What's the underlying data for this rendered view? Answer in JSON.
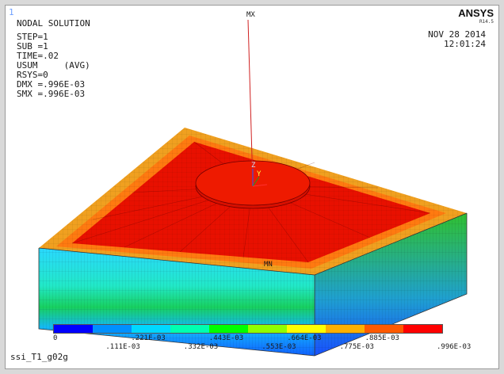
{
  "window": {
    "number": "1",
    "brand": "ANSYS",
    "brand_version": "R14.5",
    "date": "NOV 28 2014",
    "time": "12:01:24",
    "jobname": "ssi_T1_g02g"
  },
  "solution_info": {
    "title": "NODAL SOLUTION",
    "step": "STEP=1",
    "sub": "SUB =1",
    "time": "TIME=.02",
    "usum": "USUM     (AVG)",
    "rsys": "RSYS=0",
    "dmx": "DMX =.996E-03",
    "smx": "SMX =.996E-03"
  },
  "markers": {
    "max": "MX",
    "min": "MN",
    "axis_z": "Z",
    "axis_y": "Y"
  },
  "legend": {
    "colors": [
      "#0000ff",
      "#0090ff",
      "#00d8ff",
      "#00ffb0",
      "#00ff00",
      "#90ff00",
      "#ffff00",
      "#ffb000",
      "#ff5a00",
      "#ff0000"
    ],
    "top_labels": [
      "0",
      ".221E-03",
      ".443E-03",
      ".664E-03",
      ".885E-03"
    ],
    "bottom_labels": [
      ".111E-03",
      ".332E-03",
      ".553E-03",
      ".775E-03",
      ".996E-03"
    ]
  }
}
